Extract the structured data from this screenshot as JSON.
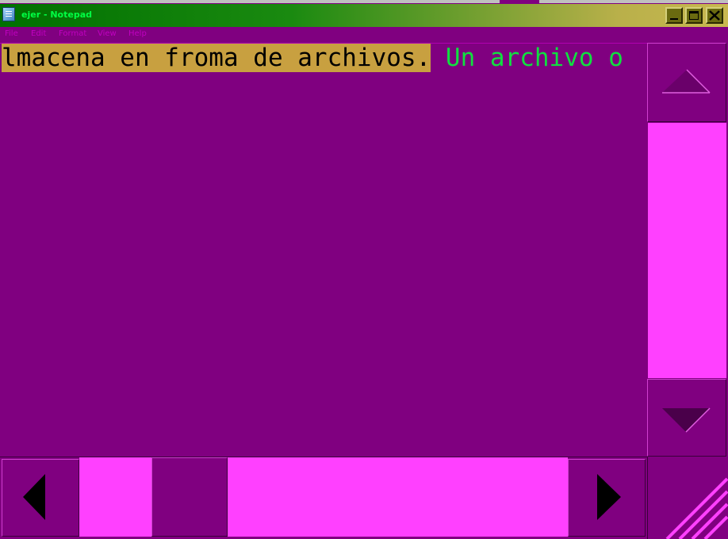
{
  "window": {
    "title": "ejer - Notepad",
    "icon": "notepad-icon",
    "controls": [
      "minimize-icon",
      "maximize-icon",
      "close-icon"
    ]
  },
  "menu": {
    "file": "File",
    "edit": "Edit",
    "format": "Format",
    "view": "View",
    "help": "Help"
  },
  "editor": {
    "selected_text": "lmacena en froma de archivos.",
    "text_after_selection": " Un archivo o"
  },
  "scrollbars": {
    "vertical": {
      "up_icon": "triangle-up-icon",
      "down_icon": "triangle-down-icon"
    },
    "horizontal": {
      "left_icon": "triangle-left-icon",
      "right_icon": "triangle-right-icon"
    }
  },
  "colors": {
    "window_bg": "#800080",
    "scroll_track": "#ff40ff",
    "selection_bg": "#c8a040",
    "text_color": "#10e040",
    "title_text": "#00ff44",
    "menu_text": "#c000c0"
  }
}
